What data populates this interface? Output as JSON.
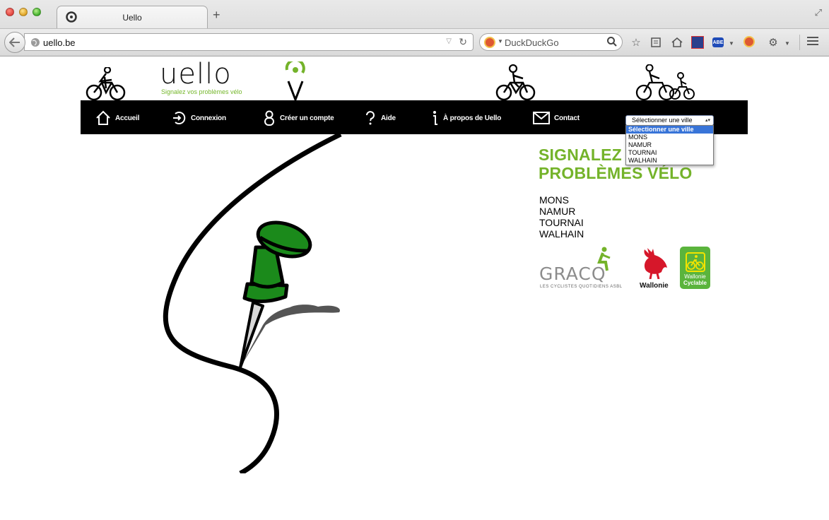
{
  "browser": {
    "tab_title": "Uello",
    "new_tab": "+",
    "url": "uello.be",
    "search_placeholder": "DuckDuckGo"
  },
  "site": {
    "logo_text": "uello",
    "tagline": "Signalez vos problèmes vélo",
    "accent_color": "#74b32a"
  },
  "nav": {
    "items": [
      {
        "label": "Accueil",
        "icon": "home-icon"
      },
      {
        "label": "Connexion",
        "icon": "login-icon"
      },
      {
        "label": "Créer un compte",
        "icon": "user-icon"
      },
      {
        "label": "Aide",
        "icon": "help-icon"
      },
      {
        "label": "À propos de Uello",
        "icon": "info-icon"
      },
      {
        "label": "Contact",
        "icon": "mail-icon"
      }
    ],
    "city_select": {
      "selected": "Sélectionner une ville",
      "options": [
        "Sélectionner une ville",
        "MONS",
        "NAMUR",
        "TOURNAI",
        "WALHAIN"
      ]
    }
  },
  "main": {
    "headline_line1": "SIGNALEZ VOS",
    "headline_line2": "PROBLÈMES VÉLO",
    "cities": [
      "MONS",
      "NAMUR",
      "TOURNAI",
      "WALHAIN"
    ]
  },
  "partners": {
    "gracq_name": "GRACQ",
    "gracq_sub": "LES CYCLISTES QUOTIDIENS ASBL",
    "wallonie": "Wallonie",
    "wallonie_cyclable_1": "Wallonie",
    "wallonie_cyclable_2": "Cyclable"
  }
}
